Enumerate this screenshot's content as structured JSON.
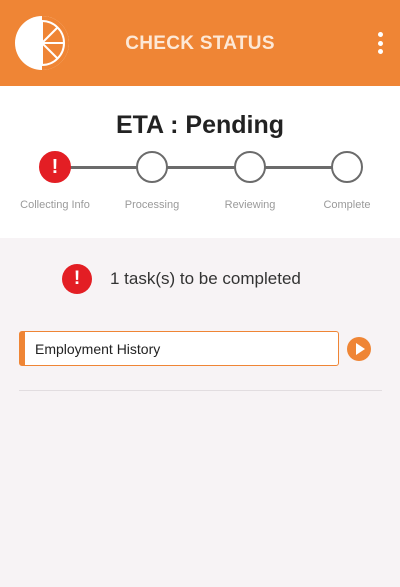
{
  "header": {
    "title": "CHECK STATUS",
    "menu_icon": "kebab-menu-icon",
    "logo_icon": "citrus-slice-logo"
  },
  "status": {
    "eta_label": "ETA",
    "eta_value": "Pending",
    "steps": [
      {
        "label": "Collecting Info",
        "state": "error",
        "icon": "exclamation-icon"
      },
      {
        "label": "Processing",
        "state": "pending"
      },
      {
        "label": "Reviewing",
        "state": "pending"
      },
      {
        "label": "Complete",
        "state": "pending"
      }
    ]
  },
  "tasks": {
    "summary_icon": "alert-icon",
    "summary": "1 task(s) to be completed",
    "items": [
      {
        "label": "Employment History",
        "action_icon": "play-circle-icon"
      }
    ]
  },
  "colors": {
    "brand": "#ef8535",
    "error": "#e31e24",
    "background": "#f7f3f5"
  }
}
